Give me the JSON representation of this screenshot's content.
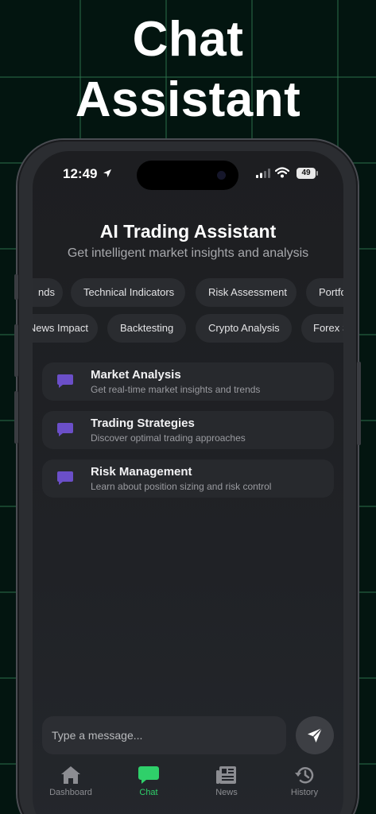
{
  "hero": {
    "line1": "Chat",
    "line2": "Assistant"
  },
  "status_bar": {
    "time": "12:49",
    "battery": "49"
  },
  "header": {
    "title": "AI Trading Assistant",
    "subtitle": "Get intelligent market insights and analysis"
  },
  "chips_row1": [
    "nds",
    "Technical Indicators",
    "Risk Assessment",
    "Portfo"
  ],
  "chips_row2": [
    "News Impact",
    "Backtesting",
    "Crypto Analysis",
    "Forex S"
  ],
  "cards": [
    {
      "title": "Market Analysis",
      "description": "Get real-time market insights and trends",
      "icon": "chat-bubble-icon"
    },
    {
      "title": "Trading Strategies",
      "description": "Discover optimal trading approaches",
      "icon": "chat-bubble-icon"
    },
    {
      "title": "Risk Management",
      "description": "Learn about position sizing and risk control",
      "icon": "chat-bubble-icon"
    }
  ],
  "composer": {
    "placeholder": "Type a message...",
    "send_icon": "send-icon"
  },
  "tabs": [
    {
      "label": "Dashboard",
      "icon": "home-icon",
      "active": false
    },
    {
      "label": "Chat",
      "icon": "chat-icon",
      "active": true
    },
    {
      "label": "News",
      "icon": "newspaper-icon",
      "active": false
    },
    {
      "label": "History",
      "icon": "history-icon",
      "active": false
    }
  ],
  "colors": {
    "accent": "#2fd06a",
    "card_icon": "#6b4fc8",
    "background": "#031510"
  }
}
